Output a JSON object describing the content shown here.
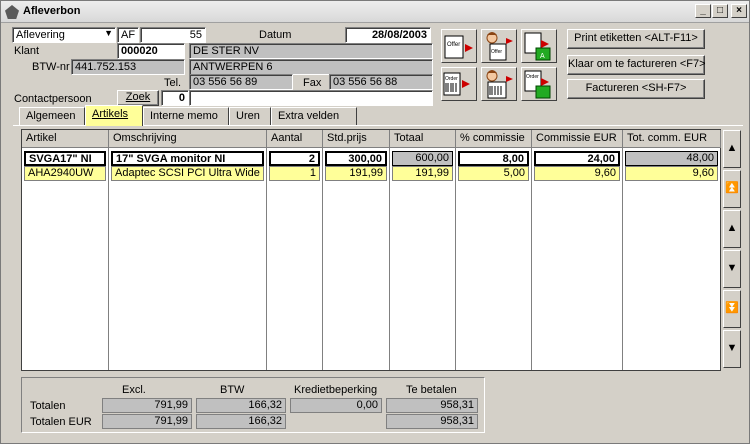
{
  "window": {
    "title": "Afleverbon",
    "min": "_",
    "max": "□",
    "close": "×"
  },
  "header": {
    "doctype_value": "Aflevering",
    "doc_code": "AF",
    "doc_number": "55",
    "datum_label": "Datum",
    "datum_value": "28/08/2003",
    "klant_label": "Klant",
    "klant_value": "000020",
    "klant_name": "DE STER NV",
    "klant_address": "ANTWERPEN 6",
    "btw_label": "BTW-nr",
    "btw_value": "441.752.153",
    "tel_label": "Tel.",
    "tel_value": "03 556 56 89",
    "fax_label": "Fax",
    "fax_value": "03 556 56 88",
    "contact_label": "Contactpersoon",
    "zoek_label": "Zoek",
    "contact_number": "0",
    "contact_value": ""
  },
  "buttons": {
    "print": "Print etiketten <ALT-F11>",
    "klaar": "Klaar om te factureren <F7>",
    "factureren": "Factureren <SH-F7>"
  },
  "icons": {
    "offer_a": "Offer",
    "offer_b": "Offer",
    "order_a": "Order",
    "order_c": "Order"
  },
  "tabs": [
    "Algemeen",
    "Artikels",
    "Interne memo",
    "Uren",
    "Extra velden"
  ],
  "table": {
    "columns": [
      "Artikel",
      "Omschrijving",
      "Aantal",
      "Std.prijs",
      "Totaal",
      "% commissie",
      "Commissie EUR",
      "Tot. comm. EUR"
    ],
    "rows": [
      [
        "SVGA17\" NI",
        "17\" SVGA monitor NI",
        "2",
        "300,00",
        "600,00",
        "8,00",
        "24,00",
        "48,00"
      ],
      [
        "AHA2940UW",
        "Adaptec SCSI PCI Ultra Wide",
        "1",
        "191,99",
        "191,99",
        "5,00",
        "9,60",
        "9,60"
      ]
    ]
  },
  "totals": {
    "headers": [
      "Excl.",
      "BTW",
      "Kredietbeperking",
      "Te betalen"
    ],
    "row1_label": "Totalen",
    "row1": [
      "791,99",
      "166,32",
      "0,00",
      "958,31"
    ],
    "row2_label": "Totalen EUR",
    "row2": [
      "791,99",
      "166,32",
      "958,31"
    ]
  },
  "colors": {
    "highlight": "#ffff99",
    "face": "#d4d0c8"
  }
}
